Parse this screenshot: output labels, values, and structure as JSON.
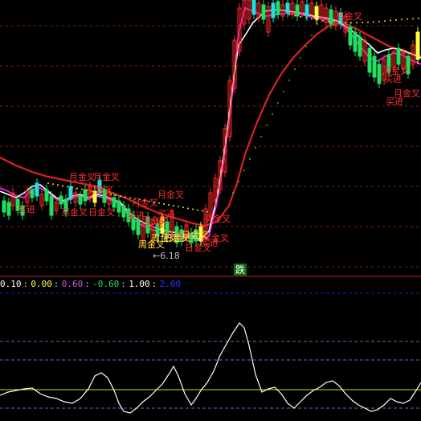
{
  "colors": {
    "background": "#000000",
    "grid_red": "#8a1a1a",
    "grid_blue": "#2020c0",
    "grid_purple": "#a050c0",
    "up_candle": "#ff2a2a",
    "down_candle": "#20e060",
    "cyan_candle": "#20e0e0",
    "yellow_candle": "#ffff40",
    "ma_white": "#ffffff",
    "ma_magenta": "#e020e0",
    "ma_red": "#e02020",
    "dots_green": "#20c020",
    "dots_yellow": "#e0e040",
    "signal_red": "#ff3030",
    "signal_gold": "#ffe040",
    "low_label": "#c0c0c0",
    "oscillator": "#ffffff",
    "osc_baseline": "#e0e000",
    "die_badge_bg": "#107010",
    "die_badge_text": "#ffffff"
  },
  "price_panel": {
    "signals": [
      {
        "text": "买进",
        "kind": "red"
      },
      {
        "text": "买金叉",
        "kind": "red"
      },
      {
        "text": "日金叉",
        "kind": "red"
      },
      {
        "text": "月金叉",
        "kind": "red"
      },
      {
        "text": "月金叉",
        "kind": "red"
      },
      {
        "text": "买金叉",
        "kind": "red"
      },
      {
        "text": "月金叉",
        "kind": "red"
      },
      {
        "text": "买进",
        "kind": "red"
      },
      {
        "text": "买进",
        "kind": "red"
      },
      {
        "text": "周金叉",
        "kind": "red"
      },
      {
        "text": "月金叉",
        "kind": "red"
      },
      {
        "text": "买进",
        "kind": "red"
      },
      {
        "text": "买金叉",
        "kind": "red"
      },
      {
        "text": "买金叉",
        "kind": "red"
      },
      {
        "text": "月金叉",
        "kind": "red"
      },
      {
        "text": "买进",
        "kind": "red"
      },
      {
        "text": "日金叉",
        "kind": "red"
      },
      {
        "text": "周金叉",
        "kind": "gold"
      },
      {
        "text": "日金叉",
        "kind": "gold"
      },
      {
        "text": "周金叉",
        "kind": "gold"
      },
      {
        "text": "日金叉",
        "kind": "gold"
      },
      {
        "text": "月金叉",
        "kind": "red"
      },
      {
        "text": "买进",
        "kind": "red"
      },
      {
        "text": "周金叉",
        "kind": "red"
      },
      {
        "text": "月金叉",
        "kind": "red"
      },
      {
        "text": "买进",
        "kind": "red"
      }
    ],
    "low_label": "←6.18",
    "die_badge": "跌"
  },
  "indicator_panel": {
    "values": [
      {
        "text": "0.10",
        "color": "#ffffff"
      },
      {
        "text": "0.00",
        "color": "#ffff40"
      },
      {
        "text": "0.60",
        "color": "#e050e0"
      },
      {
        "text": "-0.60",
        "color": "#20e060"
      },
      {
        "text": "1.00",
        "color": "#ffffff"
      },
      {
        "text": "2.00",
        "color": "#3030ff"
      }
    ],
    "separator": ":"
  }
}
